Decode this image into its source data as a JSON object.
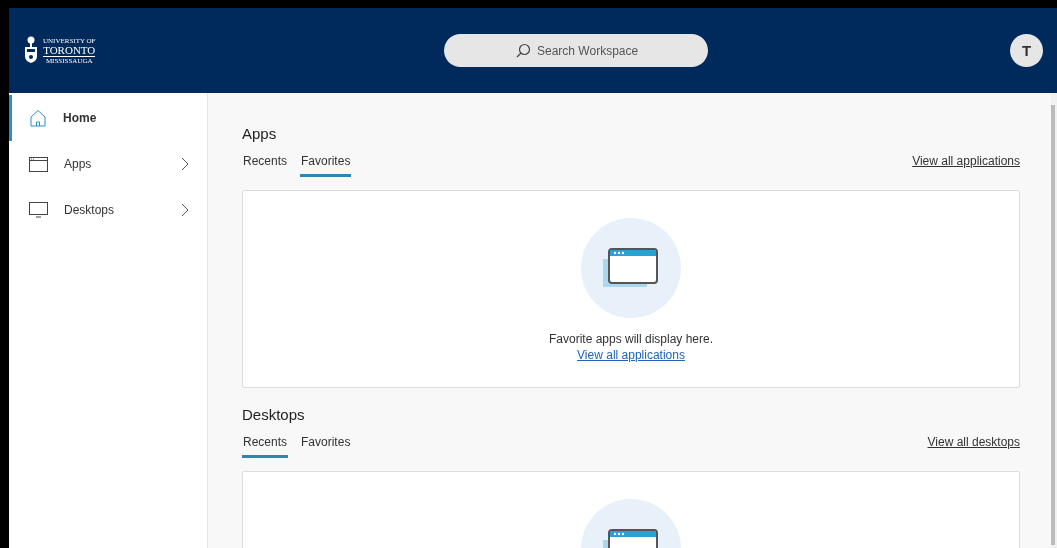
{
  "header": {
    "logo": {
      "line_1": "UNIVERSITY OF",
      "line_2": "TORONTO",
      "line_3": "MISSISSAUGA"
    },
    "search": {
      "placeholder": "Search Workspace"
    },
    "avatar": "T"
  },
  "sidebar": {
    "items": [
      {
        "label": "Home",
        "kind": "home",
        "selected": true,
        "has_chevron": false
      },
      {
        "label": "Apps",
        "kind": "apps",
        "selected": false,
        "has_chevron": true
      },
      {
        "label": "Desktops",
        "kind": "desktops",
        "selected": false,
        "has_chevron": true
      }
    ]
  },
  "sections": [
    {
      "title": "Apps",
      "tabs": [
        {
          "label": "Recents",
          "selected": false
        },
        {
          "label": "Favorites",
          "selected": true
        }
      ],
      "view_all": "View all applications",
      "empty_state": {
        "message": "Favorite apps will display here.",
        "link": "View all applications"
      }
    },
    {
      "title": "Desktops",
      "tabs": [
        {
          "label": "Recents",
          "selected": true
        },
        {
          "label": "Favorites",
          "selected": false
        }
      ],
      "view_all": "View all desktops"
    }
  ]
}
